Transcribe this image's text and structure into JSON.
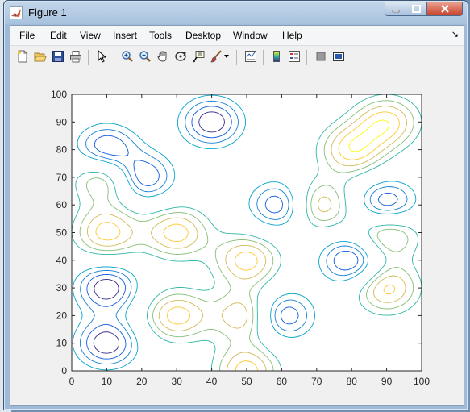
{
  "window": {
    "title": "Figure 1",
    "controls": {
      "minimize": "–",
      "maximize": "□",
      "close": "✕"
    }
  },
  "menubar": {
    "items": [
      "File",
      "Edit",
      "View",
      "Insert",
      "Tools",
      "Desktop",
      "Window",
      "Help"
    ],
    "dock_arrow": "↘"
  },
  "toolbar": {
    "icons": [
      "new-figure-icon",
      "open-file-icon",
      "save-icon",
      "print-icon",
      "edit-plot-arrow-icon",
      "zoom-in-icon",
      "zoom-out-icon",
      "pan-hand-icon",
      "rotate-3d-icon",
      "data-cursor-icon",
      "brush-icon",
      "brush-dropdown-icon",
      "link-plot-icon",
      "insert-colorbar-icon",
      "insert-legend-icon",
      "hide-plot-tools-icon",
      "show-plot-tools-icon"
    ]
  },
  "chart_data": {
    "type": "contour",
    "title": "",
    "xlabel": "",
    "ylabel": "",
    "xlim": [
      0,
      100
    ],
    "ylim": [
      0,
      100
    ],
    "xticks": [
      "0",
      "10",
      "20",
      "30",
      "40",
      "50",
      "60",
      "70",
      "80",
      "90",
      "100"
    ],
    "yticks": [
      "0",
      "10",
      "20",
      "30",
      "40",
      "50",
      "60",
      "70",
      "80",
      "90",
      "100"
    ],
    "colormap": "parula",
    "grid": false,
    "line_colors": [
      "#352a87",
      "#0f5cdd",
      "#1481d6",
      "#06a4ca",
      "#2eb7a4",
      "#87bf77",
      "#d1bb59",
      "#fec832",
      "#f9fb0e"
    ],
    "minima": [
      [
        10,
        80
      ],
      [
        40,
        90
      ],
      [
        20,
        70
      ],
      [
        60,
        60
      ],
      [
        80,
        40
      ],
      [
        10,
        30
      ],
      [
        10,
        10
      ],
      [
        60,
        20
      ],
      [
        90,
        60
      ]
    ],
    "maxima": [
      [
        10,
        70
      ],
      [
        10,
        50
      ],
      [
        30,
        50
      ],
      [
        30,
        20
      ],
      [
        50,
        40
      ],
      [
        50,
        20
      ],
      [
        80,
        80
      ],
      [
        90,
        50
      ],
      [
        90,
        90
      ],
      [
        70,
        60
      ],
      [
        90,
        30
      ],
      [
        50,
        0
      ]
    ]
  }
}
